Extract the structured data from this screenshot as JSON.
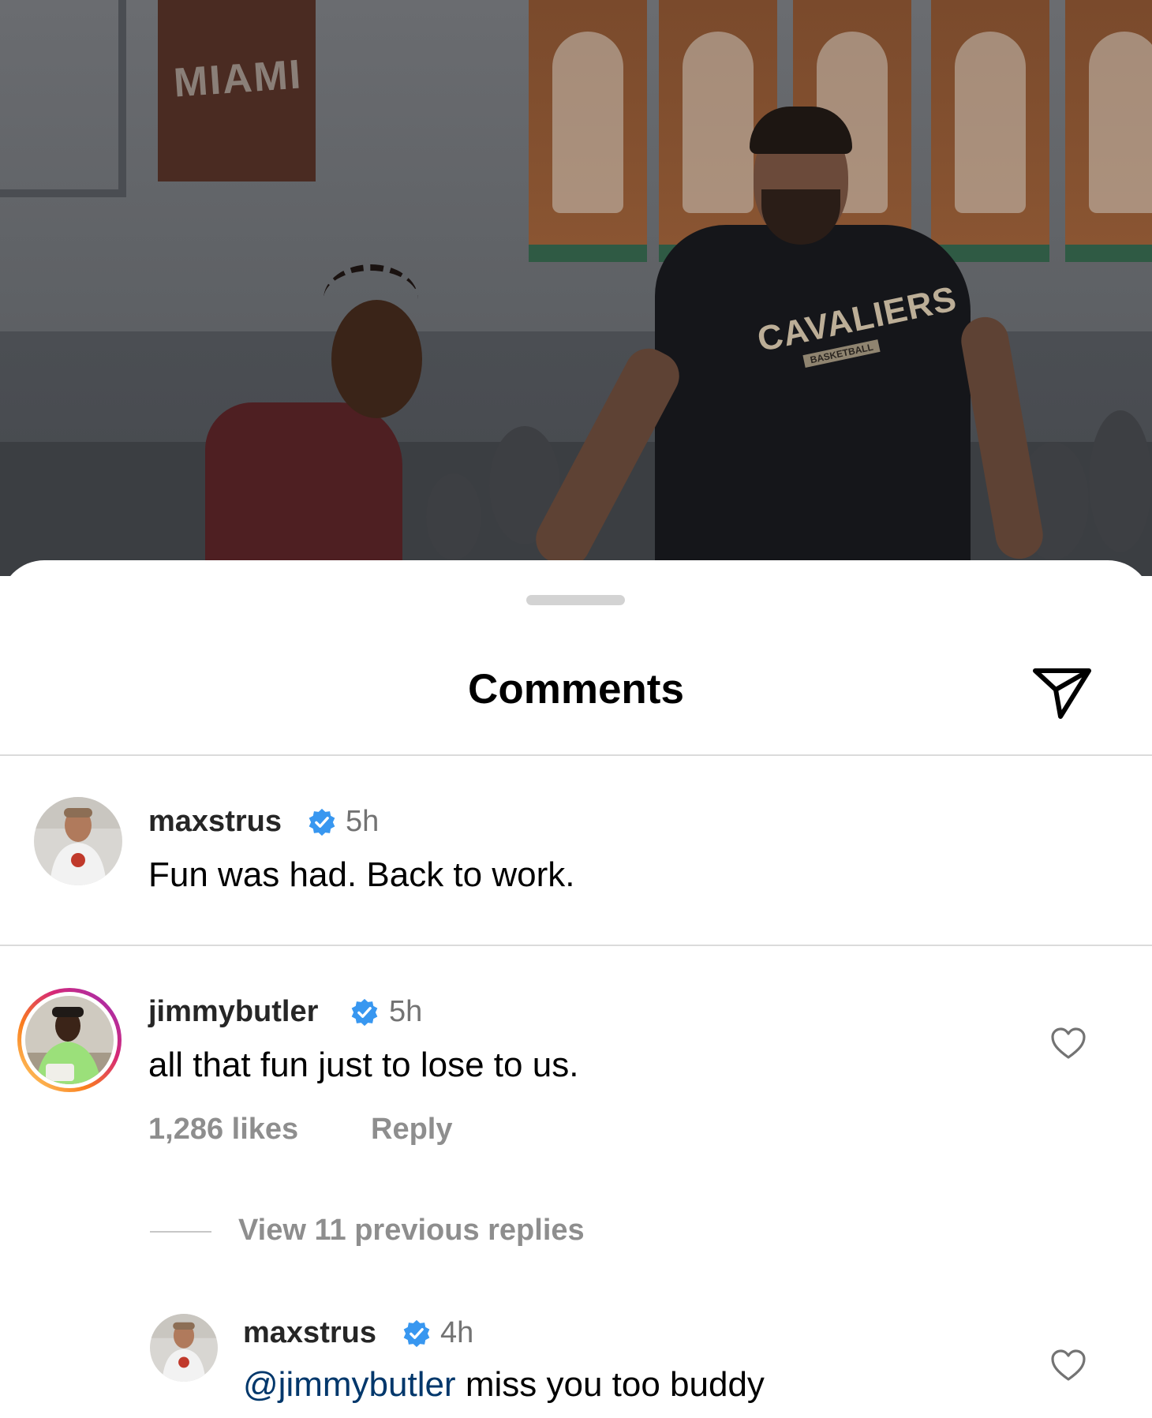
{
  "sheet": {
    "title": "Comments",
    "share_icon": "paper-plane-icon"
  },
  "photo": {
    "banner_text": "MIAMI",
    "shirt_text": "CAVALIERS",
    "shirt_subtext": "BASKETBALL"
  },
  "comments": [
    {
      "username": "maxstrus",
      "verified": true,
      "time": "5h",
      "text": "Fun was had. Back to work."
    },
    {
      "username": "jimmybutler",
      "verified": true,
      "time": "5h",
      "text": "all that fun just to lose to us.",
      "likes": "1,286 likes",
      "reply_label": "Reply",
      "view_replies": "View 11 previous replies",
      "story_ring": true
    }
  ],
  "reply": {
    "username": "maxstrus",
    "verified": true,
    "time": "4h",
    "mention": "@jimmybutler",
    "text": " miss you too buddy"
  },
  "colors": {
    "verified_blue": "#3897f0",
    "mention_blue": "#00376b",
    "secondary_text": "#737373",
    "divider": "#dbdbdb"
  }
}
